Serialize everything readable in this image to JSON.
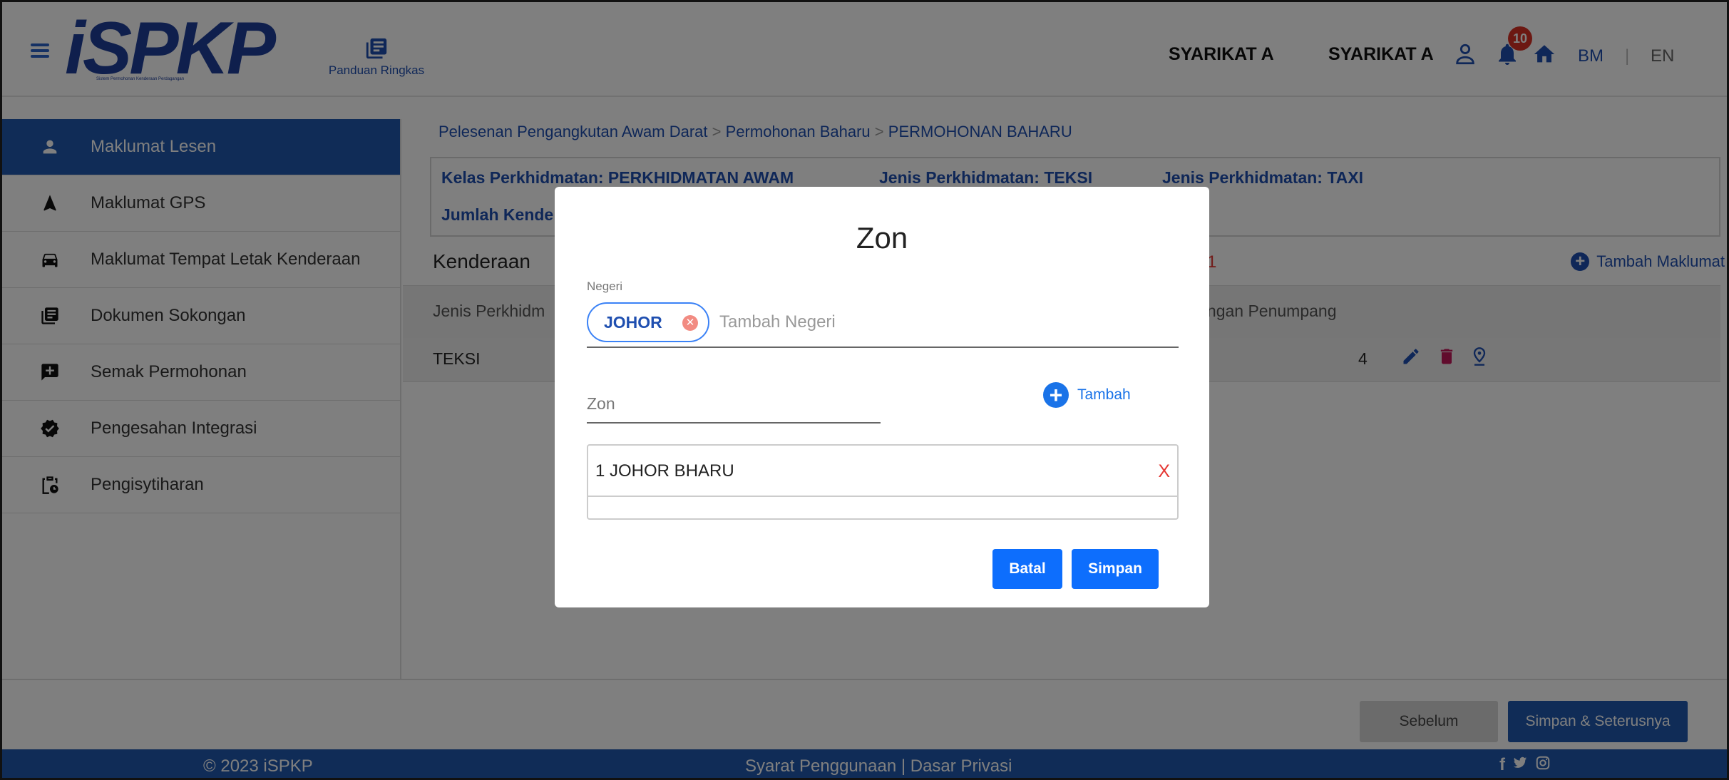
{
  "header": {
    "logo_text": "iSPKP",
    "logo_tagline": "Sistem Permohonan Kenderaan Perdagangan",
    "guide_label": "Panduan Ringkas",
    "company_name_1": "SYARIKAT A",
    "company_name_2": "SYARIKAT A",
    "notification_count": "10",
    "lang_bm": "BM",
    "lang_sep": "|",
    "lang_en": "EN",
    "icons": [
      "menu-icon",
      "book-icon",
      "user-icon",
      "bell-icon",
      "home-icon"
    ]
  },
  "sidebar": {
    "items": [
      {
        "label": "Maklumat Lesen",
        "icon": "user-icon",
        "active": true
      },
      {
        "label": "Maklumat GPS",
        "icon": "navigation-icon"
      },
      {
        "label": "Maklumat Tempat Letak Kenderaan",
        "icon": "car-icon"
      },
      {
        "label": "Dokumen Sokongan",
        "icon": "document-icon"
      },
      {
        "label": "Semak Permohonan",
        "icon": "review-icon"
      },
      {
        "label": "Pengesahan Integrasi",
        "icon": "verified-icon"
      },
      {
        "label": "Pengisytiharan",
        "icon": "clipboard-clock-icon"
      }
    ]
  },
  "main": {
    "breadcrumb": [
      "Pelesenan Pengangkutan Awam Darat",
      "Permohonan Baharu",
      "PERMOHONAN BAHARU"
    ],
    "breadcrumb_sep": ">",
    "info": {
      "kelas": "Kelas Perkhidmatan: PERKHIDMATAN AWAM",
      "jenis1": "Jenis Perkhidmatan: TEKSI",
      "jenis2": "Jenis Perkhidmatan: TAXI",
      "jumlah": "Jumlah Kende"
    },
    "section_title": "Kenderaan",
    "section_count": "1",
    "add_info_label": "Tambah Maklumat",
    "table": {
      "headers": [
        "Jenis Perkhidm",
        "langan Penumpang"
      ],
      "rows": [
        {
          "jenis": "TEKSI",
          "penumpang": "4"
        }
      ]
    }
  },
  "bottom": {
    "prev_label": "Sebelum",
    "next_label": "Simpan & Seterusnya"
  },
  "footer": {
    "copyright": "© 2023 iSPKP",
    "terms": "Syarat Penggunaan",
    "terms_sep": " | ",
    "privacy": "Dasar Privasi",
    "social": [
      "f",
      "🐦",
      "◎"
    ]
  },
  "modal": {
    "title": "Zon",
    "negeri_label": "Negeri",
    "negeri_chip": "JOHOR",
    "negeri_placeholder": "Tambah Negeri",
    "zon_placeholder": "Zon",
    "tambah_label": "Tambah",
    "zones": [
      {
        "label": "1 JOHOR BHARU",
        "delete": "X"
      }
    ],
    "cancel_label": "Batal",
    "save_label": "Simpan"
  },
  "colors": {
    "primary": "#2059ae",
    "link": "#1f4fb0",
    "button": "#0d6efd",
    "danger": "#e53935",
    "badge": "#d93025"
  }
}
